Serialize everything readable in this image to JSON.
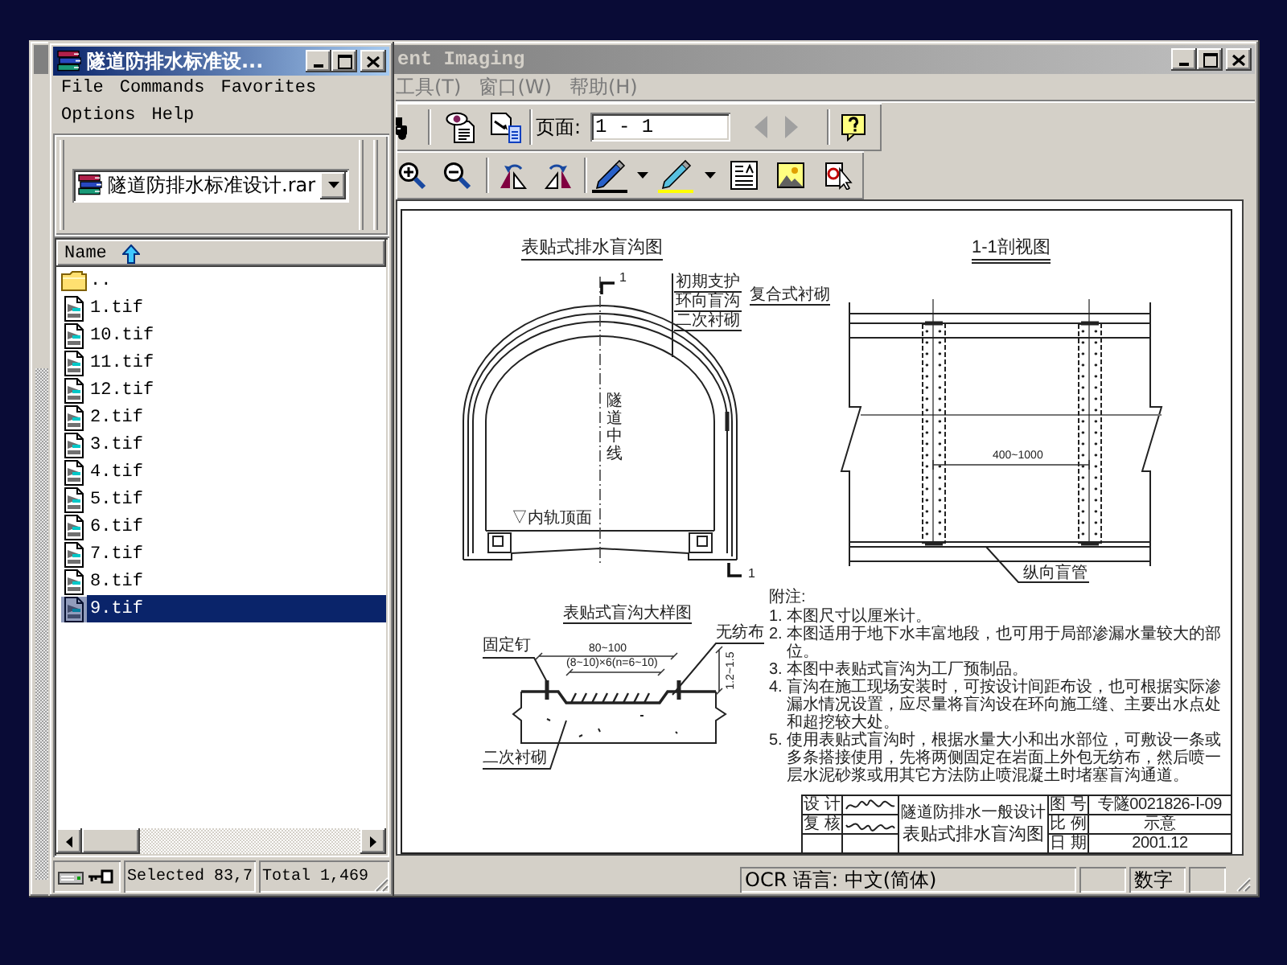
{
  "archive_window": {
    "title": "隧道防排水标准设...",
    "active": true,
    "menu": [
      {
        "label": "File"
      },
      {
        "label": "Commands"
      },
      {
        "label": "Favorites"
      },
      {
        "label": "Options"
      },
      {
        "label": "Help"
      }
    ],
    "address": {
      "value": "隧道防排水标准设计.rar"
    },
    "list": {
      "columns": [
        {
          "label": "Name",
          "sorted": true,
          "ascending": true
        }
      ],
      "rows": [
        {
          "name": "..",
          "kind": "folder",
          "selected": false
        },
        {
          "name": "1.tif",
          "kind": "file",
          "selected": false
        },
        {
          "name": "10.tif",
          "kind": "file",
          "selected": false
        },
        {
          "name": "11.tif",
          "kind": "file",
          "selected": false
        },
        {
          "name": "12.tif",
          "kind": "file",
          "selected": false
        },
        {
          "name": "2.tif",
          "kind": "file",
          "selected": false
        },
        {
          "name": "3.tif",
          "kind": "file",
          "selected": false
        },
        {
          "name": "4.tif",
          "kind": "file",
          "selected": false
        },
        {
          "name": "5.tif",
          "kind": "file",
          "selected": false
        },
        {
          "name": "6.tif",
          "kind": "file",
          "selected": false
        },
        {
          "name": "7.tif",
          "kind": "file",
          "selected": false
        },
        {
          "name": "8.tif",
          "kind": "file",
          "selected": false
        },
        {
          "name": "9.tif",
          "kind": "file",
          "selected": true
        }
      ]
    },
    "status_bar": {
      "selection": "Selected 83,7",
      "total": "Total 1,469"
    }
  },
  "viewer_window": {
    "title": "ent Imaging",
    "active": false,
    "menu": [
      {
        "label": "工具(T)",
        "disabled": true
      },
      {
        "label": "窗口(W)",
        "disabled": true
      },
      {
        "label": "帮助(H)",
        "disabled": true
      }
    ],
    "page_field": {
      "label": "页面:",
      "value": "1 - 1"
    },
    "page_nav": [
      {
        "kind": "previous",
        "disabled": true
      },
      {
        "kind": "next",
        "disabled": true
      }
    ],
    "drawing": {
      "main_title": "表贴式排水盲沟图",
      "section_marks": [
        "1",
        "1"
      ],
      "layers": [
        "初期支护",
        "环向盲沟",
        "二次衬砌"
      ],
      "lining_title": "复合式衬砌",
      "centerline": "隧道中线",
      "rail_level": "▽内轨顶面",
      "section_title": "1-1剖视图",
      "spacing": "400~1000",
      "pipe": "纵向盲管",
      "detail_title": "表贴式盲沟大样图",
      "detail_labels": {
        "fabric": "无纺布",
        "nail": "固定钉",
        "width": "80~100",
        "ribs": "(8~10)×6(n=6~10)",
        "height": "1.2~1.5",
        "lining": "二次衬砌"
      },
      "notes": {
        "heading": "附注:",
        "items": [
          "1. 本图尺寸以厘米计。",
          "2. 本图适用于地下水丰富地段，也可用于局部渗漏水量较大的部位。",
          "3. 本图中表贴式盲沟为工厂预制品。",
          "4. 盲沟在施工现场安装时，可按设计间距布设，也可根据实际渗漏水情况设置，应尽量将盲沟设在环向施工缝、主要出水点处和超挖较大处。",
          "5. 使用表贴式盲沟时，根据水量大小和出水部位，可敷设一条或多条搭接使用，先将两侧固定在岩面上外包无纺布，然后喷一层水泥砂浆或用其它方法防止喷混凝土时堵塞盲沟通道。"
        ]
      },
      "title_block": {
        "design": "设 计",
        "check": "复 核",
        "series": "隧道防排水一般设计",
        "title": "表贴式排水盲沟图",
        "fields": [
          {
            "label": "图 号",
            "value": "专隧0021826-Ⅰ-09"
          },
          {
            "label": "比 例",
            "value": "示意"
          },
          {
            "label": "日 期",
            "value": "2001.12"
          }
        ]
      }
    },
    "status_bar": {
      "ocr_language": "OCR 语言: 中文(简体)",
      "keyboard": "数字"
    }
  }
}
